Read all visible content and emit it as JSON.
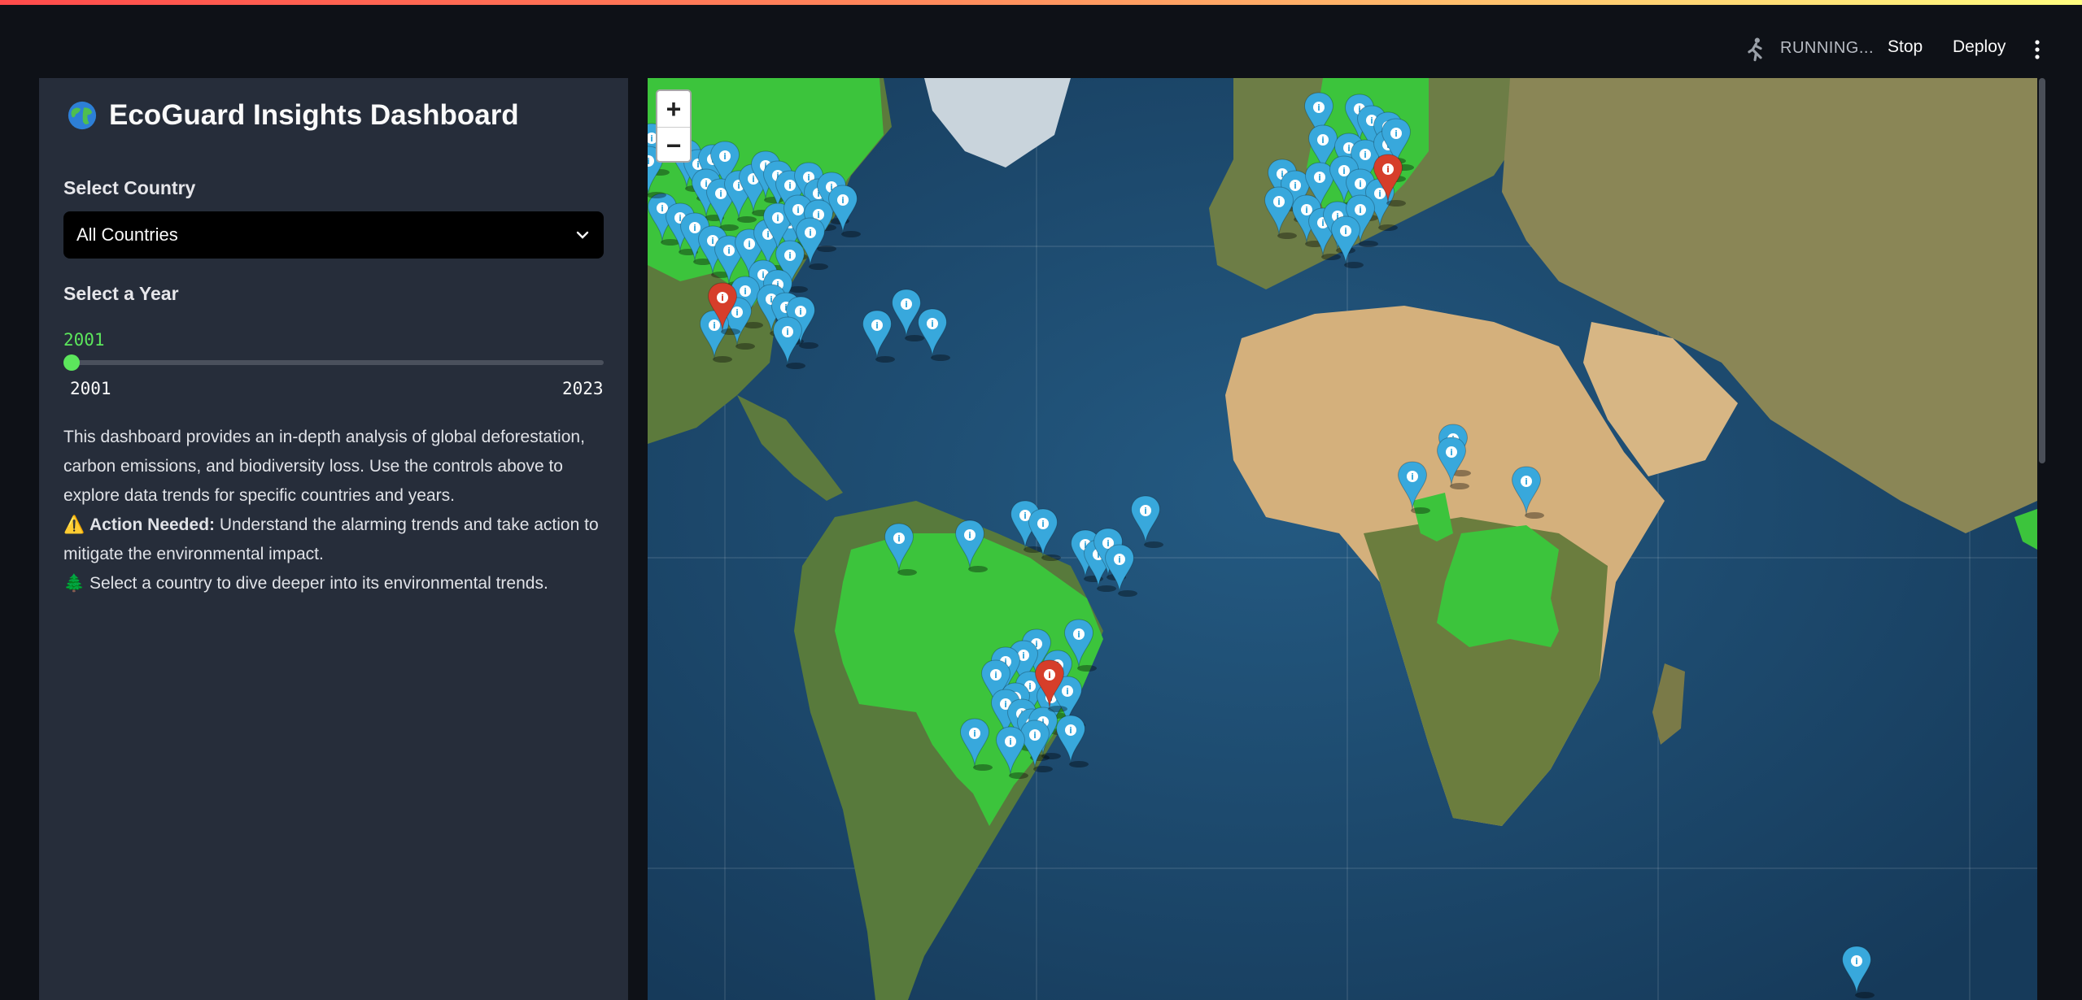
{
  "header": {
    "status": "RUNNING...",
    "stop_label": "Stop",
    "deploy_label": "Deploy"
  },
  "sidebar": {
    "title": "EcoGuard Insights Dashboard",
    "country_label": "Select Country",
    "country_value": "All Countries",
    "year_label": "Select a Year",
    "year_value": "2001",
    "year_min": "2001",
    "year_max": "2023",
    "year_fraction": 0,
    "desc_1": "This dashboard provides an in-depth analysis of global deforestation, carbon emissions, and biodiversity loss. Use the controls above to explore data trends for specific countries and years.",
    "warning_icon": "⚠️",
    "action_bold": "Action Needed:",
    "action_text": " Understand the alarming trends and take action to mitigate the environmental impact.",
    "tree_icon": "🌲",
    "tip_text": " Select a country to dive deeper into its environmental trends."
  },
  "map": {
    "zoom_in": "+",
    "zoom_out": "−",
    "marker_glyph": "i"
  },
  "colors": {
    "accent": "#ff4b4b",
    "highlight_country": "#3cc43c",
    "marker_blue": "#38a8dc",
    "marker_red": "#d63e2a",
    "slider": "#5ce65c"
  }
}
